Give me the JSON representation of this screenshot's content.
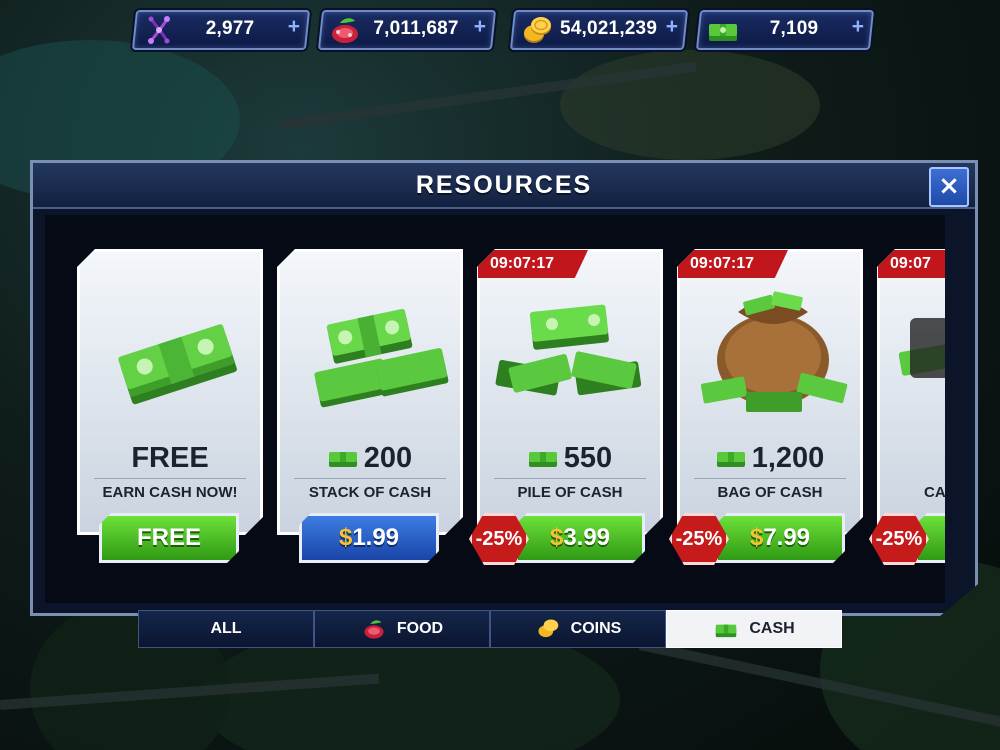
{
  "resources": [
    {
      "name": "dna",
      "icon": "dna-icon",
      "value": "2,977",
      "plus": "+"
    },
    {
      "name": "food",
      "icon": "food-icon",
      "value": "7,011,687",
      "plus": "+"
    },
    {
      "name": "coins",
      "icon": "coins-icon",
      "value": "54,021,239",
      "plus": "+"
    },
    {
      "name": "cash",
      "icon": "cash-icon",
      "value": "7,109",
      "plus": "+"
    }
  ],
  "panel": {
    "title": "RESOURCES",
    "close_label": "×"
  },
  "cards": [
    {
      "amount": "FREE",
      "name": "EARN CASH NOW!",
      "price": "FREE",
      "price_symbol": "",
      "button_style": "green",
      "timer": "",
      "discount": ""
    },
    {
      "amount": "200",
      "name": "STACK OF CASH",
      "price": "1.99",
      "price_symbol": "$",
      "button_style": "blue",
      "timer": "",
      "discount": ""
    },
    {
      "amount": "550",
      "name": "PILE OF CASH",
      "price": "3.99",
      "price_symbol": "$",
      "button_style": "green",
      "timer": "09:07:17",
      "discount": "-25%"
    },
    {
      "amount": "1,200",
      "name": "BAG OF CASH",
      "price": "7.99",
      "price_symbol": "$",
      "button_style": "green",
      "timer": "09:07:17",
      "discount": "-25%"
    },
    {
      "amount": "",
      "name": "CA",
      "price": "",
      "price_symbol": "",
      "button_style": "green",
      "timer": "09:07",
      "discount": "-25%"
    }
  ],
  "tabs": [
    {
      "label": "ALL",
      "icon": "",
      "active": false
    },
    {
      "label": "FOOD",
      "icon": "food-icon",
      "active": false
    },
    {
      "label": "COINS",
      "icon": "coins-icon",
      "active": false
    },
    {
      "label": "CASH",
      "icon": "cash-icon",
      "active": true
    }
  ],
  "colors": {
    "accent_green": "#3fbf1e",
    "accent_blue": "#2a5fcf",
    "discount_red": "#c51b1b",
    "price_gold": "#f4c430",
    "panel_bg": "#0b1428"
  }
}
